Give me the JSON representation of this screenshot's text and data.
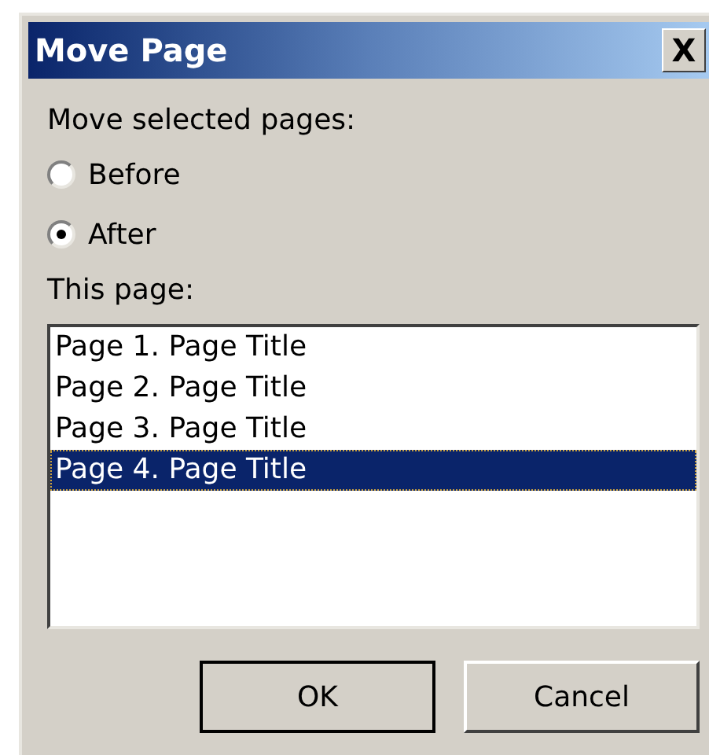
{
  "window": {
    "title": "Move Page",
    "close": "X"
  },
  "move_label": "Move selected pages:",
  "options": [
    {
      "label": "Before",
      "selected": false
    },
    {
      "label": "After",
      "selected": true
    }
  ],
  "list_label": "This page:",
  "pages": [
    {
      "label": "Page 1. Page Title",
      "selected": false
    },
    {
      "label": "Page 2. Page Title",
      "selected": false
    },
    {
      "label": "Page 3. Page Title",
      "selected": false
    },
    {
      "label": "Page 4. Page Title",
      "selected": true
    }
  ],
  "buttons": [
    "OK",
    "Cancel"
  ]
}
